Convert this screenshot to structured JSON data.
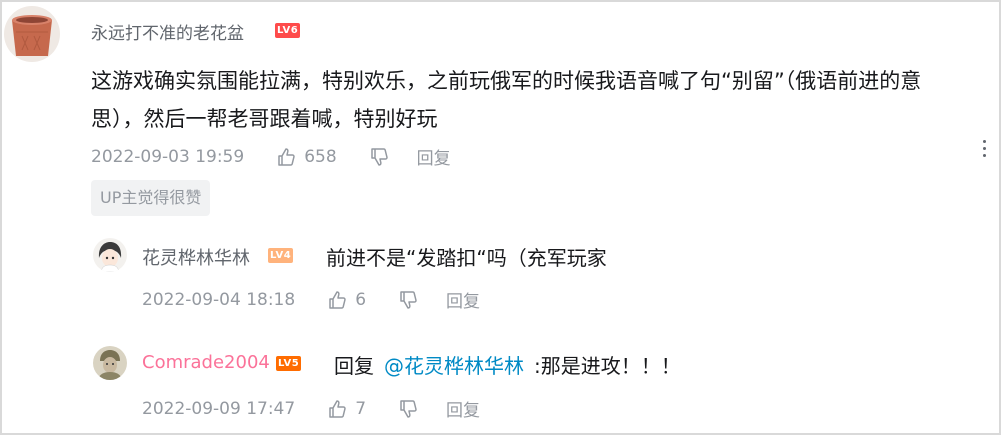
{
  "main_comment": {
    "username": "永远打不准的老花盆",
    "level": "LV6",
    "content_line1": "这游戏确实氛围能拉满，特别欢乐，之前玩俄军的时候我语音喊了句“别留”（俄语前进的意",
    "content_line2": "思），然后一帮老哥跟着喊，特别好玩",
    "timestamp": "2022-09-03 19:59",
    "likes": "658",
    "reply_label": "回复",
    "up_tag": "UP主觉得很赞"
  },
  "replies": [
    {
      "username": "花灵桦林华林",
      "level": "LV4",
      "content": "前进不是“发踏扣“吗（充军玩家",
      "timestamp": "2022-09-04 18:18",
      "likes": "6",
      "reply_label": "回复"
    },
    {
      "username": "Comrade2004",
      "level": "LV5",
      "reply_prefix": "回复",
      "mention": "@花灵桦林华林",
      "content": ":那是进攻！！！",
      "timestamp": "2022-09-09 17:47",
      "likes": "7",
      "reply_label": "回复"
    }
  ],
  "icons": [
    "like-icon",
    "dislike-icon",
    "more-icon",
    "pot-avatar",
    "anime-avatar",
    "soldier-avatar"
  ],
  "colors": {
    "accent_mention": "#008ac5",
    "level6": "#fe4b4b",
    "level5": "#ff6c00",
    "level4": "#ffb37c",
    "meta_gray": "#9499a0",
    "comrade_name": "#fb7299"
  }
}
